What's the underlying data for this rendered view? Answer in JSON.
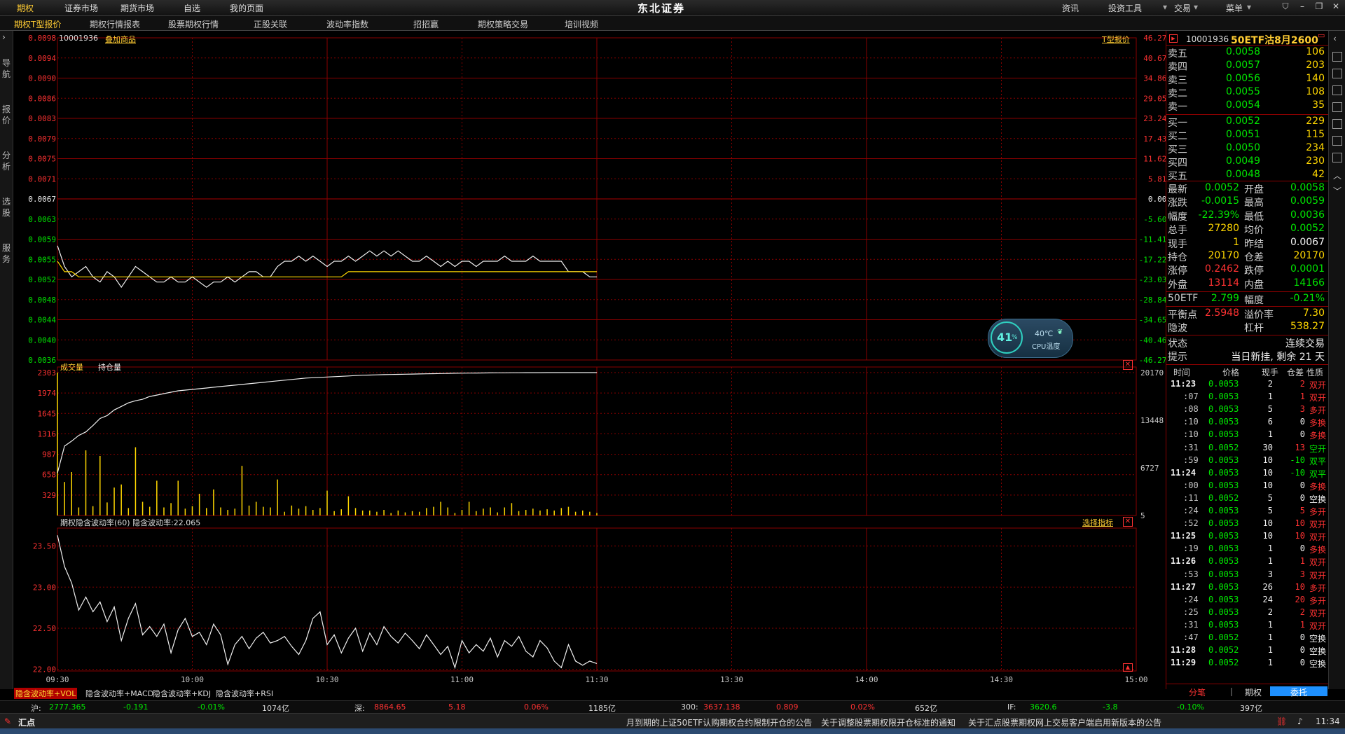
{
  "topbar": {
    "menus": [
      "期权",
      "证券市场",
      "期货市场",
      "自选",
      "我的页面"
    ],
    "brand": "东北证券",
    "right_menus": [
      "资讯",
      "投资工具",
      "交易",
      "菜单"
    ]
  },
  "subtabs": [
    "期权T型报价",
    "期权行情报表",
    "股票期权行情",
    "正股关联",
    "波动率指数",
    "招招赢",
    "期权策略交易",
    "培训视频"
  ],
  "left_strip": [
    "导航",
    "报价",
    "分析",
    "选股",
    "服务"
  ],
  "chart_header": {
    "code": "10001936",
    "add_label": "叠加商品",
    "t_quote": "T型报价"
  },
  "colors": {
    "up": "#ff3232",
    "down": "#00e600",
    "grid": "#8a0000",
    "price_line": "#f0f0f0",
    "avg_line": "#ffd700"
  },
  "chart_data": [
    {
      "type": "line",
      "title": "",
      "x": [
        "09:30",
        "10:00",
        "10:30",
        "11:00",
        "11:30",
        "13:30",
        "14:00",
        "14:30",
        "15:00"
      ],
      "y_ticks": [
        "0.0098",
        "0.0094",
        "0.0090",
        "0.0086",
        "0.0083",
        "0.0079",
        "0.0075",
        "0.0071",
        "0.0067",
        "0.0063",
        "0.0059",
        "0.0055",
        "0.0052",
        "0.0048",
        "0.0044",
        "0.0040",
        "0.0036"
      ],
      "pct_ticks": [
        "46.27%",
        "40.67%",
        "34.86%",
        "29.05%",
        "23.24%",
        "17.43%",
        "11.62%",
        "5.81%",
        "0.00%",
        "-5.60%",
        "-11.41%",
        "-17.22%",
        "-23.03%",
        "-28.84%",
        "-34.65%",
        "-40.46%",
        "-46.27%"
      ],
      "ylim": [
        0.0036,
        0.0098
      ],
      "series": [
        {
          "name": "price",
          "values": [
            0.0058,
            0.0054,
            0.0052,
            0.0053,
            0.0054,
            0.0052,
            0.0051,
            0.0053,
            0.0052,
            0.005,
            0.0052,
            0.0054,
            0.0053,
            0.0052,
            0.0051,
            0.0051,
            0.0052,
            0.0051,
            0.0051,
            0.0052,
            0.0051,
            0.005,
            0.0051,
            0.0051,
            0.0052,
            0.0051,
            0.0052,
            0.0053,
            0.0053,
            0.0052,
            0.0052,
            0.0054,
            0.0055,
            0.0055,
            0.0056,
            0.0055,
            0.0056,
            0.0055,
            0.0054,
            0.0055,
            0.0055,
            0.0056,
            0.0055,
            0.0056,
            0.0057,
            0.0056,
            0.0057,
            0.0056,
            0.0057,
            0.0056,
            0.0055,
            0.0055,
            0.0056,
            0.0055,
            0.0054,
            0.0055,
            0.0054,
            0.0055,
            0.0055,
            0.0054,
            0.0055,
            0.0055,
            0.0055,
            0.0056,
            0.0055,
            0.0055,
            0.0055,
            0.0056,
            0.0055,
            0.0055,
            0.0055,
            0.0055,
            0.0053,
            0.0053,
            0.0053,
            0.0052,
            0.0052
          ]
        },
        {
          "name": "average",
          "values": [
            0.0055,
            0.0053,
            0.0053,
            0.0052,
            0.0052,
            0.0052,
            0.0052,
            0.0052,
            0.0052,
            0.0052,
            0.0052,
            0.0052,
            0.0052,
            0.0052,
            0.0052,
            0.0052,
            0.0052,
            0.0052,
            0.0052,
            0.0052,
            0.0052,
            0.0052,
            0.0052,
            0.0052,
            0.0052,
            0.0052,
            0.0052,
            0.0052,
            0.0052,
            0.0052,
            0.0052,
            0.0052,
            0.0052,
            0.0052,
            0.0052,
            0.0052,
            0.0052,
            0.0052,
            0.0052,
            0.0052,
            0.0052,
            0.0053,
            0.0053,
            0.0053,
            0.0053,
            0.0053,
            0.0053,
            0.0053,
            0.0053,
            0.0053,
            0.0053,
            0.0053,
            0.0053,
            0.0053,
            0.0053,
            0.0053,
            0.0053,
            0.0053,
            0.0053,
            0.0053,
            0.0053,
            0.0053,
            0.0053,
            0.0053,
            0.0053,
            0.0053,
            0.0053,
            0.0053,
            0.0053,
            0.0053,
            0.0053,
            0.0053,
            0.0053,
            0.0053,
            0.0053,
            0.0053,
            0.0053
          ]
        }
      ]
    },
    {
      "type": "bar",
      "legend": [
        "成交量",
        "持仓量"
      ],
      "y_ticks": [
        "2303",
        "1974",
        "1645",
        "1316",
        "987",
        "658",
        "329"
      ],
      "right_ticks": [
        "20170",
        "13448",
        "6727",
        "5"
      ],
      "ylim": [
        0,
        2303
      ],
      "oi_lim": [
        5,
        20170
      ],
      "series": [
        {
          "name": "成交量",
          "values": [
            2303,
            540,
            700,
            130,
            1050,
            150,
            960,
            210,
            450,
            500,
            120,
            1100,
            220,
            140,
            560,
            130,
            200,
            560,
            110,
            150,
            350,
            120,
            420,
            130,
            90,
            110,
            800,
            160,
            220,
            140,
            130,
            580,
            60,
            160,
            110,
            150,
            90,
            120,
            400,
            70,
            100,
            310,
            120,
            80,
            80,
            60,
            90,
            40,
            80,
            50,
            70,
            60,
            120,
            140,
            220,
            130,
            40,
            90,
            220,
            70,
            110,
            130,
            50,
            130,
            200,
            70,
            90,
            110,
            80,
            100,
            80,
            120,
            140,
            60,
            80,
            60,
            40
          ]
        },
        {
          "name": "持仓量",
          "values": [
            6000,
            9800,
            10500,
            11300,
            11800,
            12700,
            13700,
            14100,
            14900,
            15400,
            15900,
            16200,
            16400,
            16800,
            17000,
            17200,
            17400,
            17600,
            17700,
            17800,
            17900,
            18000,
            18100,
            18200,
            18300,
            18400,
            18500,
            18600,
            18700,
            18800,
            18900,
            19000,
            19100,
            19200,
            19300,
            19400,
            19450,
            19500,
            19550,
            19600,
            19650,
            19700,
            19750,
            19800,
            19820,
            19850,
            19880,
            19900,
            19920,
            19940,
            19960,
            19980,
            20000,
            20020,
            20040,
            20060,
            20080,
            20090,
            20100,
            20110,
            20120,
            20130,
            20140,
            20145,
            20150,
            20155,
            20160,
            20162,
            20164,
            20166,
            20167,
            20168,
            20168,
            20169,
            20169,
            20170,
            20170
          ]
        }
      ]
    },
    {
      "type": "line",
      "header": "期权隐含波动率(60) 隐含波动率:22.065",
      "select_label": "选择指标",
      "y_ticks": [
        "23.50",
        "23.00",
        "22.50",
        "22.00"
      ],
      "ylim": [
        21.98,
        23.65
      ],
      "series": [
        {
          "name": "隐含波动率",
          "values": [
            23.63,
            23.25,
            23.05,
            22.72,
            22.88,
            22.7,
            22.82,
            22.58,
            22.76,
            22.35,
            22.62,
            22.8,
            22.42,
            22.52,
            22.4,
            22.55,
            22.2,
            22.48,
            22.62,
            22.4,
            22.45,
            22.3,
            22.55,
            22.42,
            22.06,
            22.3,
            22.4,
            22.25,
            22.38,
            22.45,
            22.32,
            22.35,
            22.4,
            22.28,
            22.18,
            22.35,
            22.62,
            22.7,
            22.3,
            22.42,
            22.2,
            22.38,
            22.5,
            22.22,
            22.44,
            22.3,
            22.52,
            22.4,
            22.32,
            22.44,
            22.35,
            22.25,
            22.42,
            22.3,
            22.18,
            22.28,
            22.02,
            22.35,
            22.2,
            22.3,
            22.22,
            22.38,
            22.15,
            22.35,
            22.28,
            22.4,
            22.22,
            22.15,
            22.35,
            22.26,
            22.1,
            22.02,
            22.3,
            22.1,
            22.05,
            22.1,
            22.07
          ]
        }
      ]
    }
  ],
  "x_axis": [
    "09:30",
    "10:00",
    "10:30",
    "11:00",
    "11:30",
    "13:30",
    "14:00",
    "14:30",
    "15:00"
  ],
  "quote": {
    "code": "10001936",
    "name": "50ETF沽8月2600",
    "asks": [
      {
        "label": "卖五",
        "price": "0.0058",
        "vol": "106"
      },
      {
        "label": "卖四",
        "price": "0.0057",
        "vol": "203"
      },
      {
        "label": "卖三",
        "price": "0.0056",
        "vol": "140"
      },
      {
        "label": "卖二",
        "price": "0.0055",
        "vol": "108"
      },
      {
        "label": "卖一",
        "price": "0.0054",
        "vol": "35"
      }
    ],
    "bids": [
      {
        "label": "买一",
        "price": "0.0052",
        "vol": "229"
      },
      {
        "label": "买二",
        "price": "0.0051",
        "vol": "115"
      },
      {
        "label": "买三",
        "price": "0.0050",
        "vol": "234"
      },
      {
        "label": "买四",
        "price": "0.0049",
        "vol": "230"
      },
      {
        "label": "买五",
        "price": "0.0048",
        "vol": "42"
      }
    ],
    "stats": [
      {
        "l1": "最新",
        "v1": "0.0052",
        "c1": "grn",
        "l2": "开盘",
        "v2": "0.0058",
        "c2": "grn"
      },
      {
        "l1": "涨跌",
        "v1": "-0.0015",
        "c1": "grn",
        "l2": "最高",
        "v2": "0.0059",
        "c2": "grn"
      },
      {
        "l1": "幅度",
        "v1": "-22.39%",
        "c1": "grn",
        "l2": "最低",
        "v2": "0.0036",
        "c2": "grn"
      },
      {
        "l1": "总手",
        "v1": "27280",
        "c1": "yel",
        "l2": "均价",
        "v2": "0.0052",
        "c2": "grn"
      },
      {
        "l1": "现手",
        "v1": "1",
        "c1": "yel",
        "l2": "昨结",
        "v2": "0.0067",
        "c2": "wht"
      },
      {
        "l1": "持仓",
        "v1": "20170",
        "c1": "yel",
        "l2": "仓差",
        "v2": "20170",
        "c2": "yel"
      },
      {
        "l1": "涨停",
        "v1": "0.2462",
        "c1": "red",
        "l2": "跌停",
        "v2": "0.0001",
        "c2": "grn"
      },
      {
        "l1": "外盘",
        "v1": "13114",
        "c1": "red",
        "l2": "内盘",
        "v2": "14166",
        "c2": "grn"
      }
    ],
    "etf": {
      "label": "50ETF",
      "price": "2.799",
      "l2": "幅度",
      "pct": "-0.21%"
    },
    "extra": [
      {
        "l1": "平衡点",
        "v1": "2.5948",
        "c1": "red",
        "l2": "溢价率",
        "v2": "7.30",
        "c2": "yel"
      },
      {
        "l1": "隐波",
        "v1": "",
        "c1": "yel",
        "l2": "杠杆",
        "v2": "538.27",
        "c2": "yel"
      }
    ],
    "status_label": "状态",
    "status_value": "连续交易",
    "hint_label": "提示",
    "hint_value": "当日新挂, 剩余 21 天",
    "ticks_header": [
      "时间",
      "价格",
      "现手",
      "仓差",
      "性质"
    ],
    "ticks": [
      {
        "t": "11:23",
        "p": "0.0053",
        "h": "2",
        "d": "2",
        "k": "双开",
        "c": "red",
        "bold": true
      },
      {
        "t": ":07",
        "p": "0.0053",
        "h": "1",
        "d": "1",
        "k": "双开",
        "c": "red"
      },
      {
        "t": ":08",
        "p": "0.0053",
        "h": "5",
        "d": "3",
        "k": "多开",
        "c": "red"
      },
      {
        "t": ":10",
        "p": "0.0053",
        "h": "6",
        "d": "0",
        "k": "多换",
        "c": "red"
      },
      {
        "t": ":10",
        "p": "0.0053",
        "h": "1",
        "d": "0",
        "k": "多换",
        "c": "red"
      },
      {
        "t": ":31",
        "p": "0.0052",
        "h": "30",
        "d": "13",
        "k": "空开",
        "c": "grn"
      },
      {
        "t": ":59",
        "p": "0.0053",
        "h": "10",
        "d": "-10",
        "k": "双平",
        "c": "grn"
      },
      {
        "t": "11:24",
        "p": "0.0053",
        "h": "10",
        "d": "-10",
        "k": "双平",
        "c": "grn",
        "bold": true
      },
      {
        "t": ":00",
        "p": "0.0053",
        "h": "10",
        "d": "0",
        "k": "多换",
        "c": "red"
      },
      {
        "t": ":11",
        "p": "0.0052",
        "h": "5",
        "d": "0",
        "k": "空换",
        "c": "wht"
      },
      {
        "t": ":24",
        "p": "0.0053",
        "h": "5",
        "d": "5",
        "k": "多开",
        "c": "red"
      },
      {
        "t": ":52",
        "p": "0.0053",
        "h": "10",
        "d": "10",
        "k": "双开",
        "c": "red"
      },
      {
        "t": "11:25",
        "p": "0.0053",
        "h": "10",
        "d": "10",
        "k": "双开",
        "c": "red",
        "bold": true
      },
      {
        "t": ":19",
        "p": "0.0053",
        "h": "1",
        "d": "0",
        "k": "多换",
        "c": "red"
      },
      {
        "t": "11:26",
        "p": "0.0053",
        "h": "1",
        "d": "1",
        "k": "双开",
        "c": "red",
        "bold": true
      },
      {
        "t": ":53",
        "p": "0.0053",
        "h": "3",
        "d": "3",
        "k": "双开",
        "c": "red"
      },
      {
        "t": "11:27",
        "p": "0.0053",
        "h": "26",
        "d": "10",
        "k": "多开",
        "c": "red",
        "bold": true
      },
      {
        "t": ":24",
        "p": "0.0053",
        "h": "24",
        "d": "20",
        "k": "多开",
        "c": "red"
      },
      {
        "t": ":25",
        "p": "0.0053",
        "h": "2",
        "d": "2",
        "k": "双开",
        "c": "red"
      },
      {
        "t": ":31",
        "p": "0.0053",
        "h": "1",
        "d": "1",
        "k": "双开",
        "c": "red"
      },
      {
        "t": ":47",
        "p": "0.0052",
        "h": "1",
        "d": "0",
        "k": "空换",
        "c": "wht"
      },
      {
        "t": "11:28",
        "p": "0.0052",
        "h": "1",
        "d": "0",
        "k": "空换",
        "c": "wht",
        "bold": true
      },
      {
        "t": "11:29",
        "p": "0.0052",
        "h": "1",
        "d": "0",
        "k": "空换",
        "c": "wht",
        "bold": true
      }
    ],
    "bottom_tabs": [
      "分笔",
      "期权",
      "委托"
    ]
  },
  "bottom_tabs": [
    "隐含波动率+VOL",
    "隐含波动率+MACD",
    "隐含波动率+KDJ",
    "隐含波动率+RSI"
  ],
  "status": {
    "sh_label": "沪:",
    "sh_val": "2777.365",
    "sh_chg": "-0.191",
    "sh_pct": "-0.01%",
    "sh_amt": "1074亿",
    "sz_label": "深:",
    "sz_val": "8864.65",
    "sz_chg": "5.18",
    "sz_pct": "0.06%",
    "sz_amt": "1185亿",
    "i300_label": "300:",
    "i300_val": "3637.138",
    "i300_chg": "0.809",
    "i300_pct": "0.02%",
    "i300_amt": "652亿",
    "if_label": "IF:",
    "if_val": "3620.6",
    "if_chg": "-3.8",
    "if_pct": "-0.10%",
    "if_amt": "397亿"
  },
  "ticker": {
    "logo": "汇点",
    "news": [
      "月到期的上证50ETF认购期权合约限制开仓的公告",
      "关于调整股票期权限开仓标准的通知",
      "关于汇点股票期权网上交易客户端启用新版本的公告"
    ],
    "time": "11:34"
  },
  "widget": {
    "pct": "41",
    "pct_unit": "%",
    "temp": "40℃",
    "label": "CPU温度"
  }
}
